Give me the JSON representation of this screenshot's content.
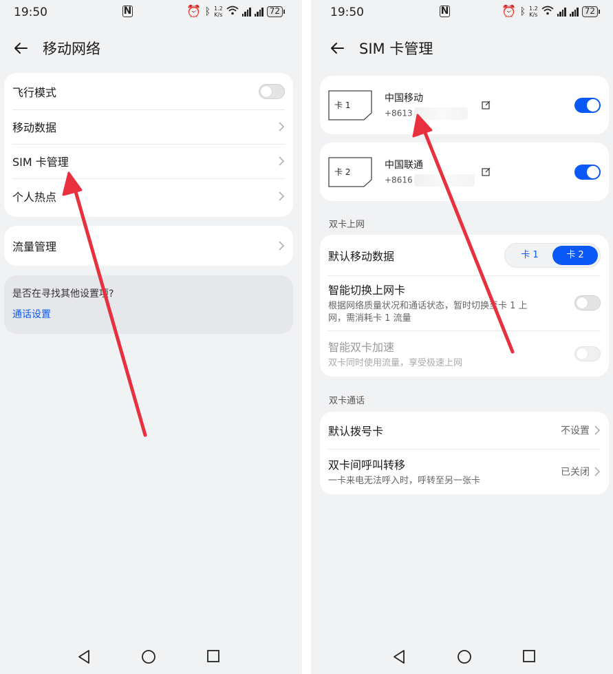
{
  "colors": {
    "accent": "#0a59f7",
    "arrow": "#e8303e",
    "background": "#f1f2f4"
  },
  "left": {
    "status": {
      "time": "19:50",
      "speed_top": "1.2",
      "speed_bottom": "K/s",
      "battery": "72"
    },
    "header": {
      "title": "移动网络"
    },
    "group1": [
      {
        "label": "飞行模式",
        "control": "toggle-off"
      },
      {
        "label": "移动数据",
        "control": "chevron"
      },
      {
        "label": "SIM 卡管理",
        "control": "chevron"
      },
      {
        "label": "个人热点",
        "control": "chevron"
      }
    ],
    "group2": [
      {
        "label": "流量管理",
        "control": "chevron"
      }
    ],
    "hint": {
      "question": "是否在寻找其他设置项?",
      "link": "通话设置"
    }
  },
  "right": {
    "status": {
      "time": "19:50",
      "speed_top": "1.2",
      "speed_bottom": "K/s",
      "battery": "72"
    },
    "header": {
      "title": "SIM 卡管理"
    },
    "sim_cards": [
      {
        "slot": "卡 1",
        "operator": "中国移动",
        "number_prefix": "+8613",
        "enabled": true
      },
      {
        "slot": "卡 2",
        "operator": "中国联通",
        "number_prefix": "+8616",
        "enabled": true
      }
    ],
    "dual_data": {
      "section_title": "双卡上网",
      "default_data_label": "默认移动数据",
      "options": [
        "卡 1",
        "卡 2"
      ],
      "selected": "卡 2",
      "smart_switch": {
        "title": "智能切换上网卡",
        "desc_line1": "根据网络质量状况和通话状态，暂时切换至卡 1 上",
        "desc_line2": "网，需消耗卡 1 流量",
        "enabled": false
      },
      "smart_boost": {
        "title": "智能双卡加速",
        "desc": "双卡同时使用流量，享受极速上网",
        "enabled": false,
        "disabled": true
      }
    },
    "dual_call": {
      "section_title": "双卡通话",
      "default_dial": {
        "label": "默认拨号卡",
        "value": "不设置"
      },
      "forwarding": {
        "label": "双卡间呼叫转移",
        "desc": "一卡来电无法呼入时，呼转至另一张卡",
        "value": "已关闭"
      }
    }
  }
}
